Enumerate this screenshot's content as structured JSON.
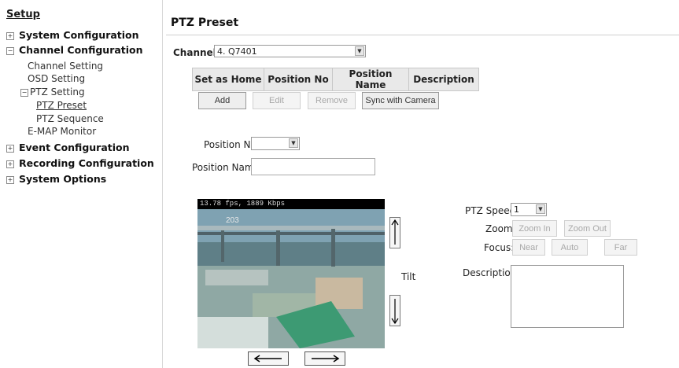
{
  "sidebar": {
    "setup_label": "Setup",
    "items": [
      {
        "label": "System Configuration",
        "toggle": "⊞"
      },
      {
        "label": "Channel Configuration",
        "toggle": "⊟"
      },
      {
        "label": "Channel Setting"
      },
      {
        "label": "OSD Setting"
      },
      {
        "label": "PTZ Setting",
        "toggle": "⊟"
      },
      {
        "label": "PTZ Preset"
      },
      {
        "label": "PTZ Sequence"
      },
      {
        "label": "E-MAP Monitor"
      },
      {
        "label": "Event Configuration",
        "toggle": "⊞"
      },
      {
        "label": "Recording Configuration",
        "toggle": "⊞"
      },
      {
        "label": "System Options",
        "toggle": "⊞"
      }
    ]
  },
  "main": {
    "title": "PTZ Preset",
    "channel_label": "Channel:",
    "channel_value": "4. Q7401",
    "table_headers": [
      "Set as Home",
      "Position No",
      "Position Name",
      "Description"
    ],
    "buttons": {
      "add": "Add",
      "edit": "Edit",
      "remove": "Remove",
      "sync": "Sync with Camera"
    },
    "position_no_label": "Position No:",
    "position_no_value": "",
    "position_name_label": "Position Name:",
    "position_name_value": ""
  },
  "video": {
    "status_text": "13.78 fps, 1889 Kbps",
    "overlay_text": "203"
  },
  "controls": {
    "tilt_label": "Tilt",
    "ptz_speed_label": "PTZ Speed:",
    "ptz_speed_value": "1",
    "zoom_label": "Zoom:",
    "zoom_in": "Zoom In",
    "zoom_out": "Zoom Out",
    "focus_label": "Focus:",
    "near": "Near",
    "auto": "Auto",
    "far": "Far",
    "description_label": "Description:",
    "description_value": ""
  },
  "colors": {
    "sidebar_border": "#d8d8d8",
    "header_bg": "#e9e9e9",
    "disabled_text": "#a8a8a8"
  }
}
